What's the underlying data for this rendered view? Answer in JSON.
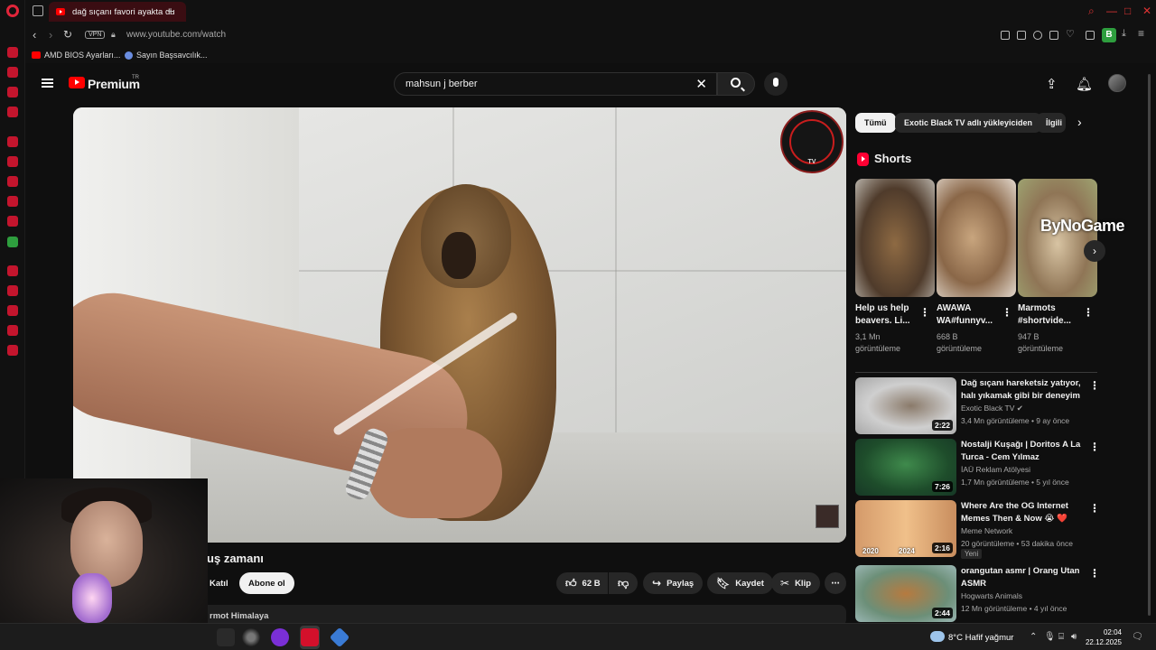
{
  "browser": {
    "tab_title": "dağ sıçanı favori ayakta du",
    "url": "www.youtube.com/watch",
    "vpn_label": "VPN",
    "ext_badge": "B",
    "bookmarks": [
      {
        "label": "AMD BIOS Ayarları..."
      },
      {
        "label": "Sayın Başsavcılık..."
      }
    ]
  },
  "header": {
    "brand": "Premium",
    "country": "TR",
    "search_query": "mahsun j berber"
  },
  "player": {
    "watermark_text": "TV"
  },
  "video": {
    "title": "ayakta duş zamanı",
    "join_label": "Katıl",
    "subscribe_label": "Abone ol",
    "like_count": "62 B",
    "share_label": "Paylaş",
    "save_label": "Kaydet",
    "clip_label": "Klip",
    "description_snippet": "rmot Himalaya"
  },
  "sidebar": {
    "chips": [
      "Tümü",
      "Exotic Black TV adlı yükleyiciden",
      "İlgili"
    ],
    "shorts_heading": "Shorts",
    "overlay_text": "ByNoGame",
    "shorts": [
      {
        "title": "Help us help beavers. Li...",
        "views": "3,1 Mn",
        "views_unit": "görüntüleme"
      },
      {
        "title": "AWAWA WA#funnyv...",
        "views": "668 B",
        "views_unit": "görüntüleme"
      },
      {
        "title": "Marmots #shortvide...",
        "views": "947 B",
        "views_unit": "görüntüleme"
      }
    ],
    "recommendations": [
      {
        "title": "Dağ sıçanı hareketsiz yatıyor, halı yıkamak gibi bir deneyim",
        "channel": "Exotic Black TV",
        "meta": "3,4 Mn görüntüleme • 9 ay önce",
        "duration": "2:22",
        "badge": ""
      },
      {
        "title": "Nostalji Kuşağı | Doritos A La Turca - Cem Yılmaz",
        "channel": "İAÜ Reklam Atölyesi",
        "meta": "1,7 Mn görüntüleme • 5 yıl önce",
        "duration": "7:26",
        "badge": ""
      },
      {
        "title": "Where Are the OG Internet Memes Then & Now 😭 ❤️",
        "channel": "Meme Network",
        "meta": "20 görüntüleme • 53 dakika önce",
        "duration": "2:16",
        "badge": "Yeni",
        "thumb_labels": [
          "2020",
          "2024"
        ]
      },
      {
        "title": "orangutan asmr | Orang Utan ASMR",
        "channel": "Hogwarts Animals",
        "meta": "12 Mn görüntüleme • 4 yıl önce",
        "duration": "2:44",
        "badge": ""
      }
    ]
  },
  "taskbar": {
    "weather": "8°C  Hafif yağmur",
    "time": "02:04",
    "date": "22.12.2025"
  }
}
